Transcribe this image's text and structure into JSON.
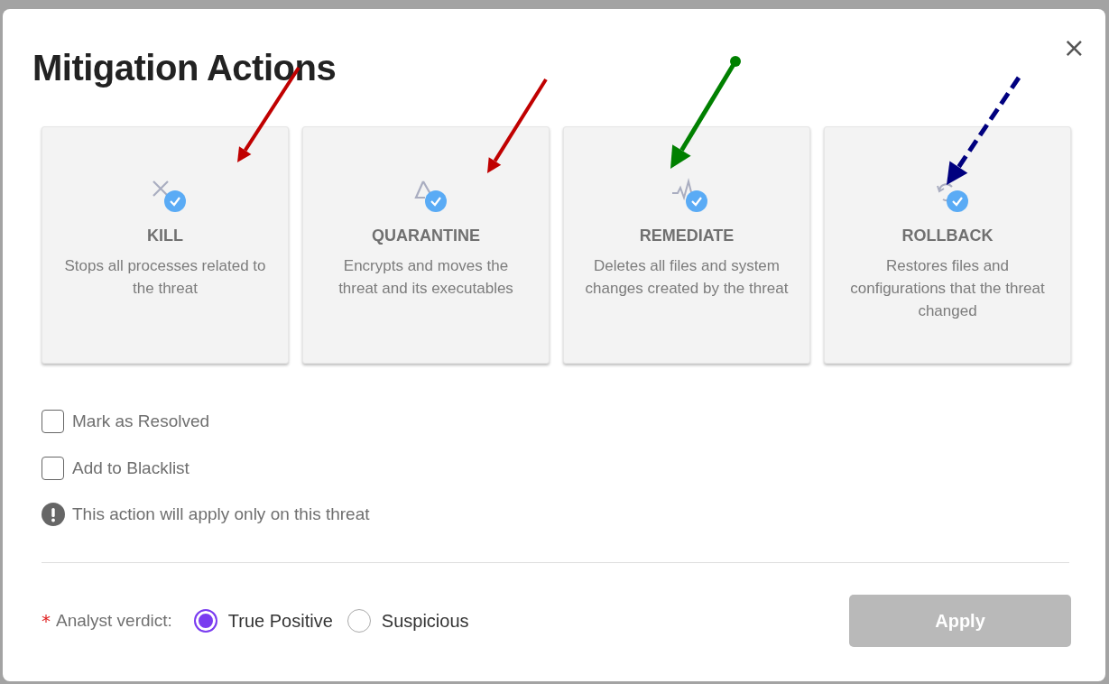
{
  "dialog": {
    "title": "Mitigation Actions",
    "close": "×"
  },
  "actions": [
    {
      "kind": "kill",
      "title": "KILL",
      "description": "Stops all processes related to the threat",
      "selected": true,
      "arrow": {
        "color": "#c00000",
        "kind": "solid"
      }
    },
    {
      "kind": "quarantine",
      "title": "QUARANTINE",
      "description": "Encrypts and moves the threat and its executables",
      "selected": true,
      "arrow": {
        "color": "#c00000",
        "kind": "solid"
      }
    },
    {
      "kind": "remediate",
      "title": "REMEDIATE",
      "description": "Deletes all files and system changes created by the threat",
      "selected": true,
      "arrow": {
        "color": "#008000",
        "kind": "dot-tail"
      }
    },
    {
      "kind": "rollback",
      "title": "ROLLBACK",
      "description": "Restores files and configurations that the threat changed",
      "selected": true,
      "arrow": {
        "color": "#00007f",
        "kind": "dashed"
      }
    }
  ],
  "options": [
    {
      "label": "Mark as Resolved",
      "checked": false
    },
    {
      "label": "Add to Blacklist",
      "checked": false
    }
  ],
  "notice": "This action will apply only on this threat",
  "verdict": {
    "required": "*",
    "label": "Analyst verdict:",
    "choices": [
      {
        "label": "True Positive",
        "selected": true
      },
      {
        "label": "Suspicious",
        "selected": false
      }
    ]
  },
  "apply": {
    "label": "Apply",
    "disabled": true
  }
}
